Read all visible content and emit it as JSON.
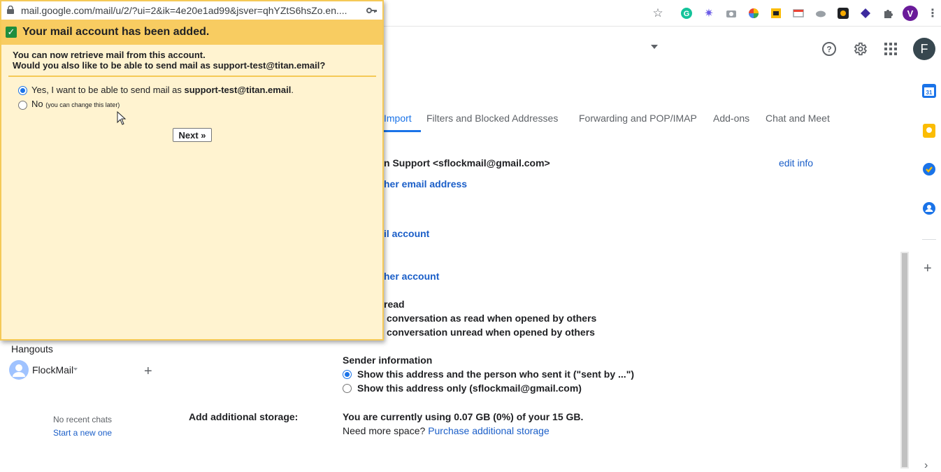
{
  "popup": {
    "url": "mail.google.com/mail/u/2/?ui=2&ik=4e20e1ad99&jsver=qhYZtS6hsZo.en....",
    "title": "Your mail account has been added.",
    "line1": "You can now retrieve mail from this account.",
    "line2": "Would you also like to be able to send mail as support-test@titan.email?",
    "option_yes_prefix": "Yes, I want to be able to send mail as ",
    "option_yes_email": "support-test@titan.email",
    "option_yes_suffix": ".",
    "option_no": "No",
    "option_no_note": "(you can change this later)",
    "next_label": "Next »"
  },
  "browser": {
    "profile_initial": "V"
  },
  "gmail": {
    "account_initial": "F",
    "tabs": [
      "Import",
      "Filters and Blocked Addresses",
      "Forwarding and POP/IMAP",
      "Add-ons",
      "Chat and Meet"
    ],
    "send_as_entry": "n Support <sflockmail@gmail.com>",
    "edit_info": "edit info",
    "add_email_link": "her email address",
    "add_mail_account_link": "il account",
    "add_another_account_link": "her account",
    "mark_read_heading": "read",
    "mark_read_option1": "conversation as read when opened by others",
    "mark_read_option2": "conversation unread when opened by others",
    "sender_info_label": "Sender information",
    "sender_option1": "Show this address and the person who sent it (\"sent by ...\")",
    "sender_option2": "Show this address only (sflockmail@gmail.com)",
    "storage_label": "Add additional storage:",
    "storage_usage": "You are currently using 0.07 GB (0%) of your 15 GB.",
    "storage_more_prefix": "Need more space? ",
    "storage_more_link": "Purchase additional storage"
  },
  "hangouts": {
    "title": "Hangouts",
    "user": "FlockMail",
    "no_chats": "No recent chats",
    "start_new": "Start a new one"
  },
  "colors": {
    "popup_bg": "#fff3d0",
    "popup_title_bg": "#f8cc61",
    "link_blue": "#1a5ec8",
    "accent_blue": "#1a73e8"
  }
}
